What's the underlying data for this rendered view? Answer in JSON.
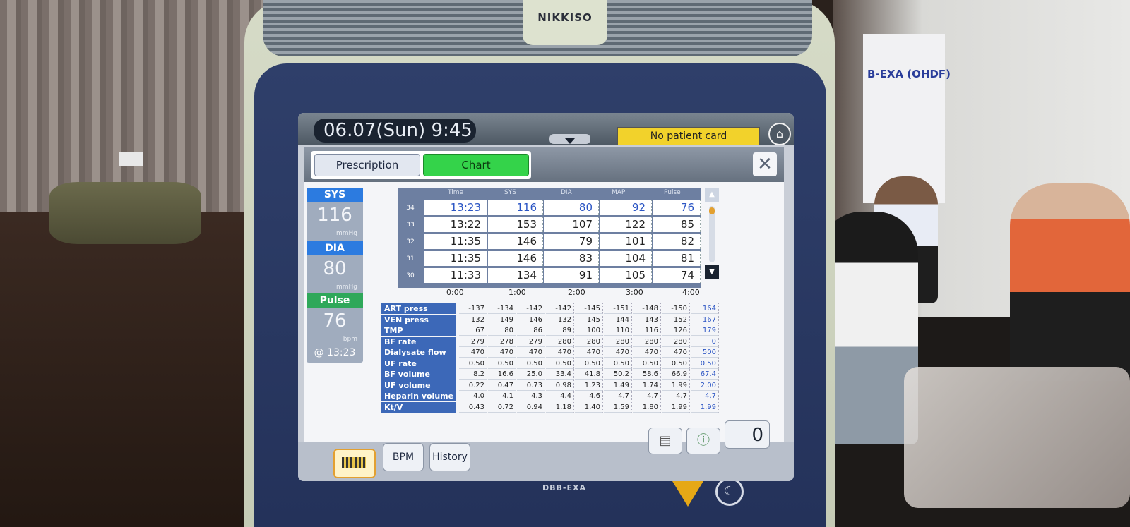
{
  "device": {
    "brand": "NIKKISO",
    "model": "DBB-EXA"
  },
  "status_bar": {
    "datetime": "06.07(Sun)  9:45",
    "patient_card": "No patient card"
  },
  "tabs": [
    {
      "label": "Prescription",
      "active": false
    },
    {
      "label": "Chart",
      "active": true
    }
  ],
  "vitals": {
    "sys": {
      "label": "SYS",
      "value": "116",
      "unit": "mmHg"
    },
    "dia": {
      "label": "DIA",
      "value": "80",
      "unit": "mmHg"
    },
    "pulse": {
      "label": "Pulse",
      "value": "76",
      "unit": "bpm"
    },
    "measured_at": "@ 13:23"
  },
  "bp_table": {
    "headers": [
      "Time",
      "SYS",
      "DIA",
      "MAP",
      "Pulse"
    ],
    "rows": [
      {
        "idx": "34",
        "time": "13:23",
        "sys": "116",
        "dia": "80",
        "map": "92",
        "pulse": "76",
        "highlight": true
      },
      {
        "idx": "33",
        "time": "13:22",
        "sys": "153",
        "dia": "107",
        "map": "122",
        "pulse": "85",
        "highlight": false
      },
      {
        "idx": "32",
        "time": "11:35",
        "sys": "146",
        "dia": "79",
        "map": "101",
        "pulse": "82",
        "highlight": false
      },
      {
        "idx": "31",
        "time": "11:35",
        "sys": "146",
        "dia": "83",
        "map": "104",
        "pulse": "81",
        "highlight": false
      },
      {
        "idx": "30",
        "time": "11:33",
        "sys": "134",
        "dia": "91",
        "map": "105",
        "pulse": "74",
        "highlight": false
      }
    ]
  },
  "trend": {
    "hours": [
      "0:00",
      "1:00",
      "2:00",
      "3:00",
      "4:00"
    ],
    "rows": [
      {
        "label": "ART press",
        "values": [
          "-137",
          "-134",
          "-142",
          "-142",
          "-145",
          "-151",
          "-148",
          "-150",
          "164"
        ]
      },
      {
        "label": "VEN press",
        "values": [
          "132",
          "149",
          "146",
          "132",
          "145",
          "144",
          "143",
          "152",
          "167"
        ]
      },
      {
        "label": "TMP",
        "values": [
          "67",
          "80",
          "86",
          "89",
          "100",
          "110",
          "116",
          "126",
          "179"
        ]
      },
      {
        "label": "BF rate",
        "values": [
          "279",
          "278",
          "279",
          "280",
          "280",
          "280",
          "280",
          "280",
          "0"
        ]
      },
      {
        "label": "Dialysate flow",
        "values": [
          "470",
          "470",
          "470",
          "470",
          "470",
          "470",
          "470",
          "470",
          "500"
        ]
      },
      {
        "label": "UF rate",
        "values": [
          "0.50",
          "0.50",
          "0.50",
          "0.50",
          "0.50",
          "0.50",
          "0.50",
          "0.50",
          "0.50"
        ]
      },
      {
        "label": "BF volume",
        "values": [
          "8.2",
          "16.6",
          "25.0",
          "33.4",
          "41.8",
          "50.2",
          "58.6",
          "66.9",
          "67.4"
        ]
      },
      {
        "label": "UF volume",
        "values": [
          "0.22",
          "0.47",
          "0.73",
          "0.98",
          "1.23",
          "1.49",
          "1.74",
          "1.99",
          "2.00"
        ]
      },
      {
        "label": "Heparin volume",
        "values": [
          "4.0",
          "4.1",
          "4.3",
          "4.4",
          "4.6",
          "4.7",
          "4.7",
          "4.7",
          "4.7"
        ]
      },
      {
        "label": "Kt/V",
        "values": [
          "0.43",
          "0.72",
          "0.94",
          "1.18",
          "1.40",
          "1.59",
          "1.80",
          "1.99",
          "1.99"
        ]
      }
    ]
  },
  "bottom_bar": {
    "bpm_label": "BPM",
    "history_label": "History",
    "counter": "0"
  },
  "background": {
    "poster_title": "B-EXA (OHDF)"
  },
  "colors": {
    "chart_tab": "#34d34a",
    "patient_card": "#f2d22b",
    "highlight_text": "#2b55c4"
  }
}
